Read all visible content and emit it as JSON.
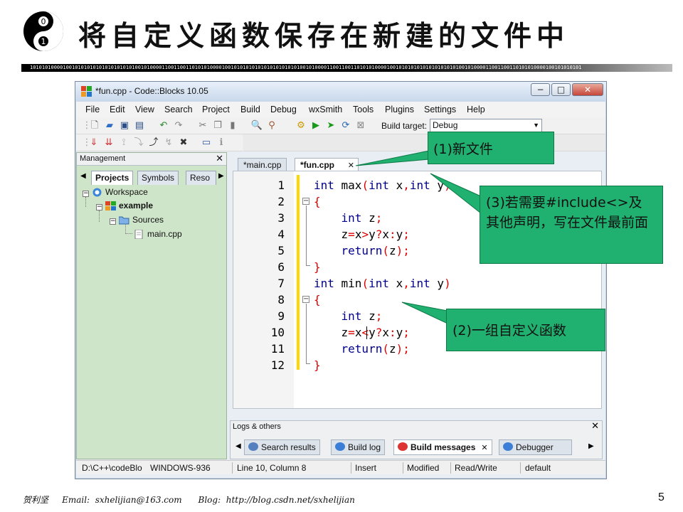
{
  "slide": {
    "title": "将自定义函数保存在新建的文件中",
    "logo_digits": [
      "0",
      "1"
    ],
    "binary_strip": "1010101000010010101010101010101010100101000011001100110101010000100101010101010101010101010010100001100110011010101000010010101010101010101010100101000011001100110101010000100101010101",
    "footer": "贺利坚     Email:  sxhelijian@163.com      Blog:  http://blog.csdn.net/sxhelijian",
    "page_number": "5"
  },
  "window": {
    "title": "*fun.cpp - Code::Blocks 10.05",
    "buttons": [
      "minimize",
      "maximize",
      "close"
    ],
    "controls": {
      "minimize": "−",
      "maximize": "□",
      "close": "✕"
    }
  },
  "menu": [
    "File",
    "Edit",
    "View",
    "Search",
    "Project",
    "Build",
    "Debug",
    "wxSmith",
    "Tools",
    "Plugins",
    "Settings",
    "Help"
  ],
  "toolbar": {
    "build_target_label": "Build target:",
    "build_target_value": "Debug",
    "icons": [
      "new-file-icon",
      "open-icon",
      "save-icon",
      "save-all-icon",
      "undo-icon",
      "redo-icon",
      "cut-icon",
      "copy-icon",
      "paste-icon",
      "find-icon",
      "replace-icon",
      "build-icon",
      "run-icon",
      "build-and-run-icon",
      "rebuild-icon",
      "abort-icon"
    ]
  },
  "management": {
    "title": "Management",
    "close_glyph": "✕",
    "tabs": [
      "Projects",
      "Symbols",
      "Reso"
    ],
    "active_tab": "Projects",
    "tree": {
      "workspace": "Workspace",
      "project": "example",
      "folder": "Sources",
      "file": "main.cpp"
    }
  },
  "editor": {
    "tabs": [
      {
        "label": "*main.cpp",
        "active": false
      },
      {
        "label": "*fun.cpp",
        "active": true
      }
    ],
    "tab_close_glyph": "✕",
    "line_numbers": [
      "1",
      "2",
      "3",
      "4",
      "5",
      "6",
      "7",
      "8",
      "9",
      "10",
      "11",
      "12"
    ],
    "code": [
      "int max(int x,int y)",
      "{",
      "    int z;",
      "    z=x>y?x:y;",
      "    return(z);",
      "}",
      "int min(int x,int y)",
      "{",
      "    int z;",
      "    z=x<y?x:y;",
      "    return(z);",
      "}"
    ],
    "keyword_color": "#00008b",
    "operator_color": "#dd0000"
  },
  "logs": {
    "title": "Logs & others",
    "close_glyph": "✕",
    "tabs": [
      {
        "label": "Search results",
        "active": false
      },
      {
        "label": "Build log",
        "active": false
      },
      {
        "label": "Build messages",
        "active": true
      },
      {
        "label": "Debugger",
        "active": false
      }
    ]
  },
  "statusbar": {
    "path": "D:\\C++\\codeBlo",
    "encoding": "WINDOWS-936",
    "position": "Line 10, Column 8",
    "mode": "Insert",
    "modified": "Modified",
    "access": "Read/Write",
    "profile": "default"
  },
  "callouts": {
    "new_file": "(1)新文件",
    "include_note": "(3)若需要#include<>及其他声明，写在文件最前面",
    "functions_note": "(2)一组自定义函数"
  },
  "colors": {
    "callout": "#20b070",
    "management_bg": "#cfe5c9",
    "change_bar": "#ffd700"
  }
}
